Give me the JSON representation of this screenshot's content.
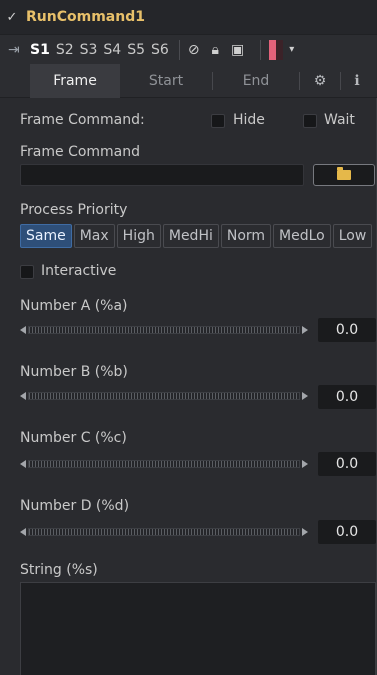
{
  "header": {
    "title": "RunCommand1"
  },
  "slots": [
    "S1",
    "S2",
    "S3",
    "S4",
    "S5",
    "S6"
  ],
  "tabs": [
    "Frame",
    "Start",
    "End"
  ],
  "frame_command_header": "Frame Command:",
  "checkboxes": {
    "hide": "Hide",
    "wait": "Wait",
    "interactive": "Interactive"
  },
  "frame_command_label": "Frame Command",
  "frame_command_value": "",
  "priority": {
    "label": "Process Priority",
    "options": [
      "Same",
      "Max",
      "High",
      "MedHi",
      "Norm",
      "MedLo",
      "Low"
    ],
    "selected": "Same"
  },
  "numbers": [
    {
      "label": "Number A (%a)",
      "value": "0.0"
    },
    {
      "label": "Number B (%b)",
      "value": "0.0"
    },
    {
      "label": "Number C (%c)",
      "value": "0.0"
    },
    {
      "label": "Number D (%d)",
      "value": "0.0"
    }
  ],
  "string_label": "String (%s)",
  "string_value": ""
}
